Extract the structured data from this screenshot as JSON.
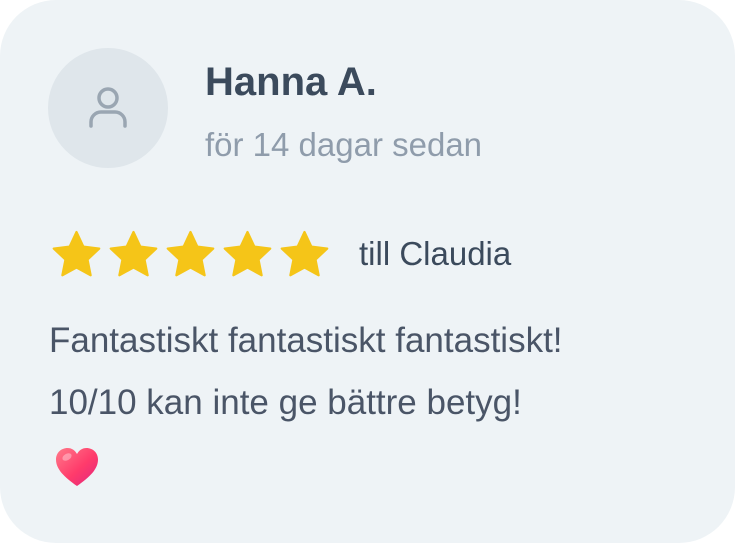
{
  "review": {
    "author": "Hanna A.",
    "time_ago": "för 14 dagar sedan",
    "rating": 5,
    "rating_max": 5,
    "target": "till Claudia",
    "text_lines": [
      "Fantastiskt fantastiskt fantastiskt!",
      "10/10 kan inte ge bättre betyg!"
    ],
    "emoji": "heart-icon"
  },
  "colors": {
    "card_background": "#eef3f6",
    "star": "#f5c518",
    "heart": "#ff3b6b"
  }
}
